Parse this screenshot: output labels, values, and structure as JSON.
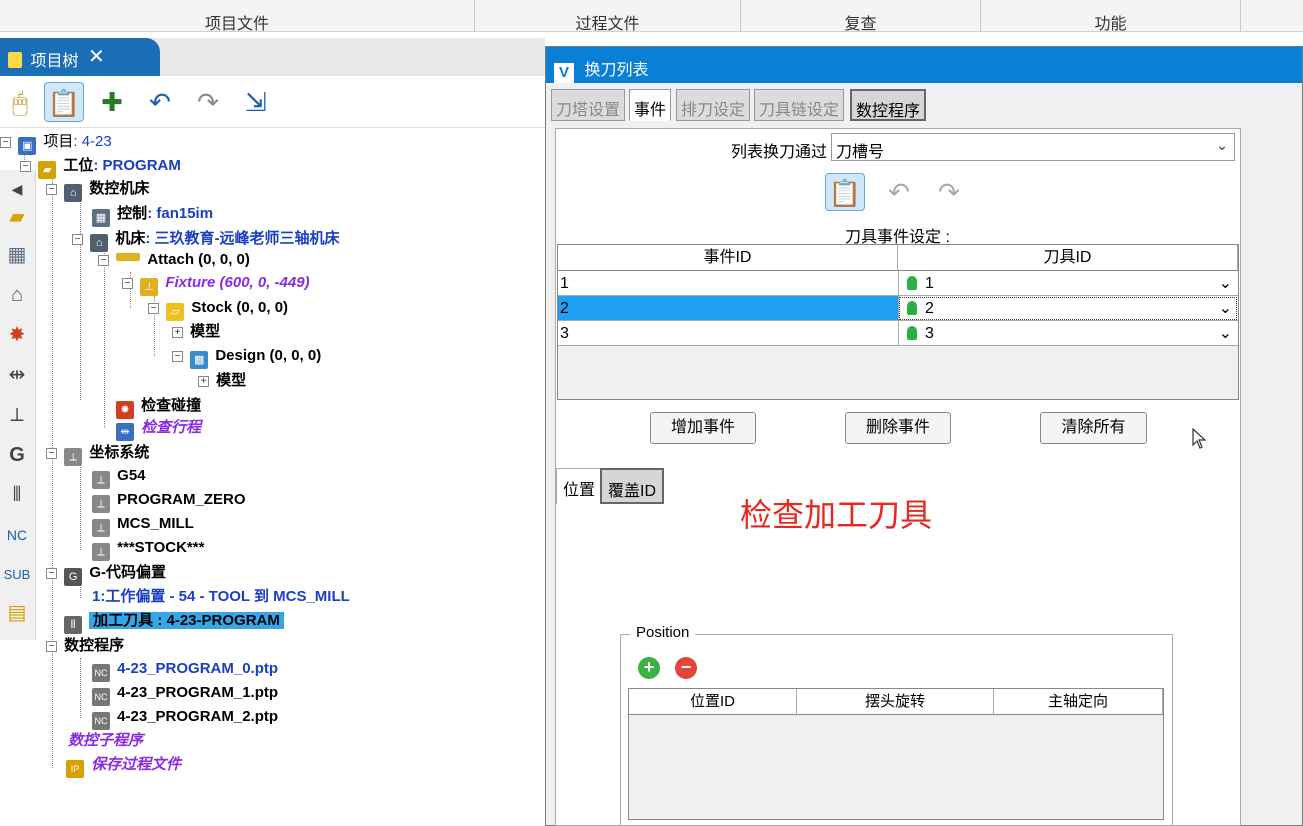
{
  "top_sections": [
    {
      "label": "项目文件"
    },
    {
      "label": "过程文件"
    },
    {
      "label": "复查"
    },
    {
      "label": "功能"
    }
  ],
  "tree_panel": {
    "tab_label": "项目树",
    "close_glyph": "✕",
    "toolbar_icons": [
      "mouse-icon",
      "notes-icon",
      "add-component-icon",
      "undo-icon",
      "redo-icon",
      "export-icon"
    ]
  },
  "tree": {
    "project": {
      "label": "项目",
      "value": ": 4-23"
    },
    "setup": {
      "label": "工位",
      "value": ": PROGRAM"
    },
    "machine_group": {
      "label": "数控机床"
    },
    "control": {
      "label": "控制",
      "value": ": fan15im"
    },
    "machine": {
      "label": "机床",
      "value": ": 三玖教育-远峰老师三轴机床"
    },
    "attach": {
      "label": "Attach (0, 0, 0)"
    },
    "fixture": {
      "label": "Fixture (600, 0, -449)"
    },
    "stock": {
      "label": "Stock (0, 0, 0)"
    },
    "stock_model": {
      "label": "模型"
    },
    "design": {
      "label": "Design (0, 0, 0)"
    },
    "design_model": {
      "label": "模型"
    },
    "collision": {
      "label": "检查碰撞"
    },
    "travel": {
      "label": "检查行程"
    },
    "coord": {
      "label": "坐标系统"
    },
    "g54": {
      "label": "G54"
    },
    "prog_zero": {
      "label": "PROGRAM_ZERO"
    },
    "mcs_mill": {
      "label": "MCS_MILL"
    },
    "stock_cs": {
      "label": "***STOCK***"
    },
    "gcode_offsets": {
      "label": "G-代码偏置"
    },
    "work_offset": {
      "label": "1:工作偏置 - 54 - TOOL 到 MCS_MILL"
    },
    "tools": {
      "label": "加工刀具 : 4-23-PROGRAM"
    },
    "nc_programs": {
      "label": "数控程序"
    },
    "prog0": {
      "label": "4-23_PROGRAM_0.ptp"
    },
    "prog1": {
      "label": "4-23_PROGRAM_1.ptp"
    },
    "prog2": {
      "label": "4-23_PROGRAM_2.ptp"
    },
    "subprograms": {
      "label": "数控子程序"
    },
    "save_process": {
      "label": "保存过程文件"
    }
  },
  "dialog": {
    "title": "换刀列表",
    "logo": "V",
    "tabs": [
      {
        "label": "刀塔设置"
      },
      {
        "label": "事件"
      },
      {
        "label": "排刀设定"
      },
      {
        "label": "刀具链设定"
      },
      {
        "label": "数控程序"
      }
    ],
    "change_by_label": "列表换刀通过",
    "change_by_value": "刀槽号",
    "event_settings_label": "刀具事件设定 :",
    "grid": {
      "headers": [
        "事件ID",
        "刀具ID"
      ],
      "rows": [
        {
          "event": "1",
          "tool": "1"
        },
        {
          "event": "2",
          "tool": "2"
        },
        {
          "event": "3",
          "tool": "3"
        }
      ]
    },
    "buttons": {
      "add": "增加事件",
      "delete": "删除事件",
      "clear": "清除所有"
    },
    "bottom_tabs": [
      {
        "label": "位置"
      },
      {
        "label": "覆盖ID"
      }
    ],
    "annotation": "检查加工刀具",
    "position_group": {
      "legend": "Position",
      "headers": [
        "位置ID",
        "摆头旋转",
        "主轴定向"
      ]
    }
  }
}
